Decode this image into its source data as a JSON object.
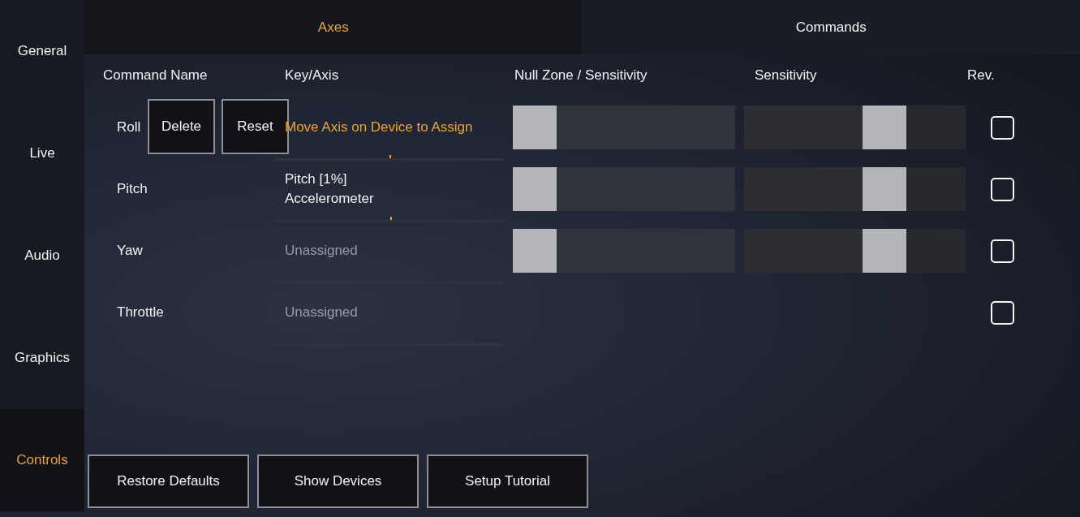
{
  "sidebar": {
    "items": [
      {
        "label": "General",
        "selected": false
      },
      {
        "label": "Live",
        "selected": false
      },
      {
        "label": "Audio",
        "selected": false
      },
      {
        "label": "Graphics",
        "selected": false
      },
      {
        "label": "Controls",
        "selected": true
      }
    ]
  },
  "tabs": [
    {
      "label": "Axes",
      "selected": true
    },
    {
      "label": "Commands",
      "selected": false
    }
  ],
  "table": {
    "columns": [
      "Command Name",
      "Key/Axis",
      "Null Zone / Sensitivity",
      "Sensitivity",
      "Rev."
    ],
    "rows": [
      {
        "name": "Roll",
        "actions": [
          "Delete",
          "Reset"
        ],
        "key": {
          "kind": "prompt",
          "lines": [
            "Move Axis on Device to Assign"
          ]
        },
        "level": 0.5,
        "null_zone": {
          "level": 0
        },
        "sensitivity": {
          "level": 0.667
        },
        "reversed": false
      },
      {
        "name": "Pitch",
        "key": {
          "kind": "assigned",
          "lines": [
            "Pitch [1%]",
            "Accelerometer"
          ]
        },
        "level": 0.505,
        "null_zone": {
          "level": 0
        },
        "sensitivity": {
          "level": 0.667
        },
        "reversed": false
      },
      {
        "name": "Yaw",
        "key": {
          "kind": "unassigned",
          "lines": [
            "Unassigned"
          ]
        },
        "null_zone": {
          "level": 0
        },
        "sensitivity": {
          "level": 0.667
        },
        "reversed": false
      },
      {
        "name": "Throttle",
        "key": {
          "kind": "unassigned",
          "lines": [
            "Unassigned"
          ]
        },
        "reversed": false
      }
    ]
  },
  "buttons": [
    "Restore Defaults",
    "Show Devices",
    "Setup Tutorial"
  ]
}
